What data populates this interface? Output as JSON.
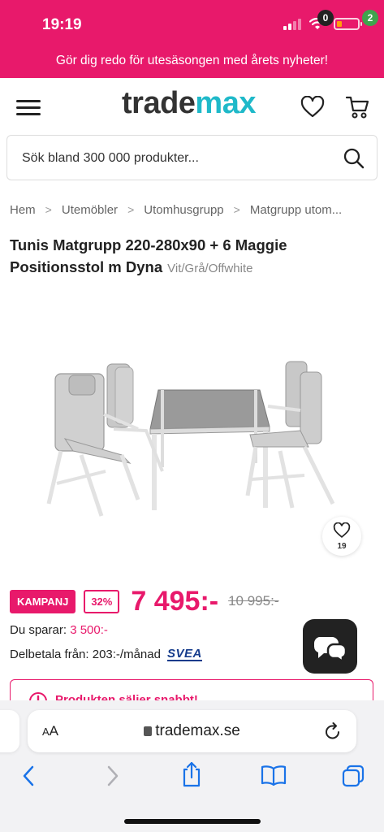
{
  "status": {
    "time": "19:19",
    "battery_level": 0.25,
    "battery_color": "#ff9f0a"
  },
  "promo": {
    "text": "Gör dig redo för utesäsongen med årets nyheter!"
  },
  "header": {
    "logo_part1": "trade",
    "logo_part2": "max",
    "wishlist_count": "0",
    "cart_count": "2",
    "brand_color": "#e8196b",
    "logo_accent": "#1fb9c9"
  },
  "search": {
    "placeholder": "Sök bland 300 000 produkter..."
  },
  "breadcrumb": [
    "Hem",
    "Utemöbler",
    "Utomhusgrupp",
    "Matgrupp utom..."
  ],
  "product": {
    "title": "Tunis Matgrupp 220-280x90 + 6 Maggie Positionsstol m Dyna",
    "variant": "Vit/Grå/Offwhite",
    "favorite_count": "19",
    "tag_campaign": "KAMPANJ",
    "tag_discount": "32%",
    "price": "7 495:-",
    "old_price": "10 995:-",
    "save_label": "Du sparar:",
    "save_amount": "3 500:-",
    "installment": "Delbetala från: 203:-/månad",
    "installment_brand": "SVEA",
    "stock_text": "Produkten säljer snabbt!"
  },
  "browser": {
    "aa_label": "AA",
    "url": "trademax.se"
  }
}
